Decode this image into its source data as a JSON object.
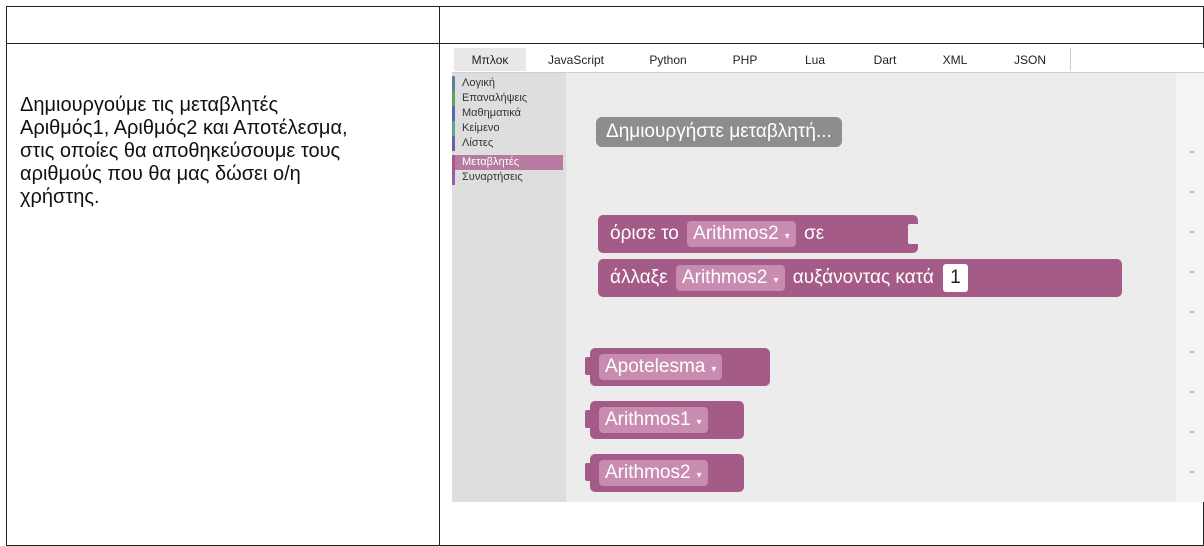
{
  "left_cell": {
    "lines": [
      "Δημιουργούμε τις μεταβλητές",
      "Αριθμός1, Αριθμός2 και Αποτέλεσμα,",
      "στις οποίες θα αποθηκεύσουμε τους",
      "αριθμούς που θα μας δώσει ο/η",
      "χρήστης."
    ]
  },
  "tabs": [
    "Μπλοκ",
    "JavaScript",
    "Python",
    "PHP",
    "Lua",
    "Dart",
    "XML",
    "JSON"
  ],
  "active_tab": "Μπλοκ",
  "toolbox": [
    {
      "label": "Λογική",
      "color": "#5b80a5"
    },
    {
      "label": "Επαναλήψεις",
      "color": "#5ba55b"
    },
    {
      "label": "Μαθηματικά",
      "color": "#5b67a5"
    },
    {
      "label": "Κείμενο",
      "color": "#5ba58c"
    },
    {
      "label": "Λίστες",
      "color": "#745ba5"
    },
    {
      "label": "Μεταβλητές",
      "color": "#a55b80"
    },
    {
      "label": "Συναρτήσεις",
      "color": "#995ba5"
    }
  ],
  "selected_category": "Μεταβλητές",
  "workspace": {
    "create_button": "Δημιουργήστε μεταβλητή...",
    "set_block": {
      "prefix": "όρισε το",
      "variable": "Arithmos2",
      "suffix": "σε"
    },
    "change_block": {
      "prefix": "άλλαξε",
      "variable": "Arithmos2",
      "suffix": "αυξάνοντας κατά",
      "value": "1"
    },
    "getters": [
      "Apotelesma",
      "Arithmos1",
      "Arithmos2"
    ],
    "dropdown_arrow": "▾"
  },
  "colors": {
    "variable_block": "#a55b87",
    "dropdown": "#c88cb0",
    "toolbox_selected": "#b77aa0"
  }
}
